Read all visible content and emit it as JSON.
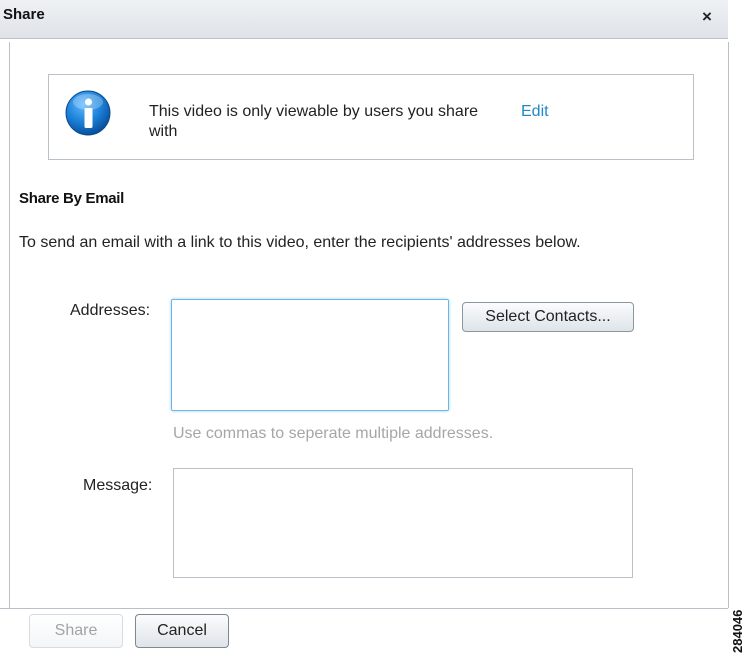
{
  "dialog": {
    "title": "Share",
    "close_label": "×"
  },
  "notice": {
    "icon": "info-icon",
    "text": "This video is only viewable by users you share with",
    "edit_label": "Edit"
  },
  "email_section": {
    "title": "Share By Email",
    "instructions": "To send an email with a link to this video, enter the recipients' addresses below.",
    "addresses_label": "Addresses:",
    "addresses_value": "",
    "select_contacts_label": "Select Contacts...",
    "addresses_hint": "Use commas to seperate multiple addresses.",
    "message_label": "Message:",
    "message_value": ""
  },
  "footer": {
    "share_label": "Share",
    "cancel_label": "Cancel"
  },
  "figure_id": "284046",
  "colors": {
    "accent": "#1e88c8",
    "info_icon": "#1a7fd6",
    "focus_border": "#6fb6e8",
    "hint_text": "#a6a6a6"
  }
}
